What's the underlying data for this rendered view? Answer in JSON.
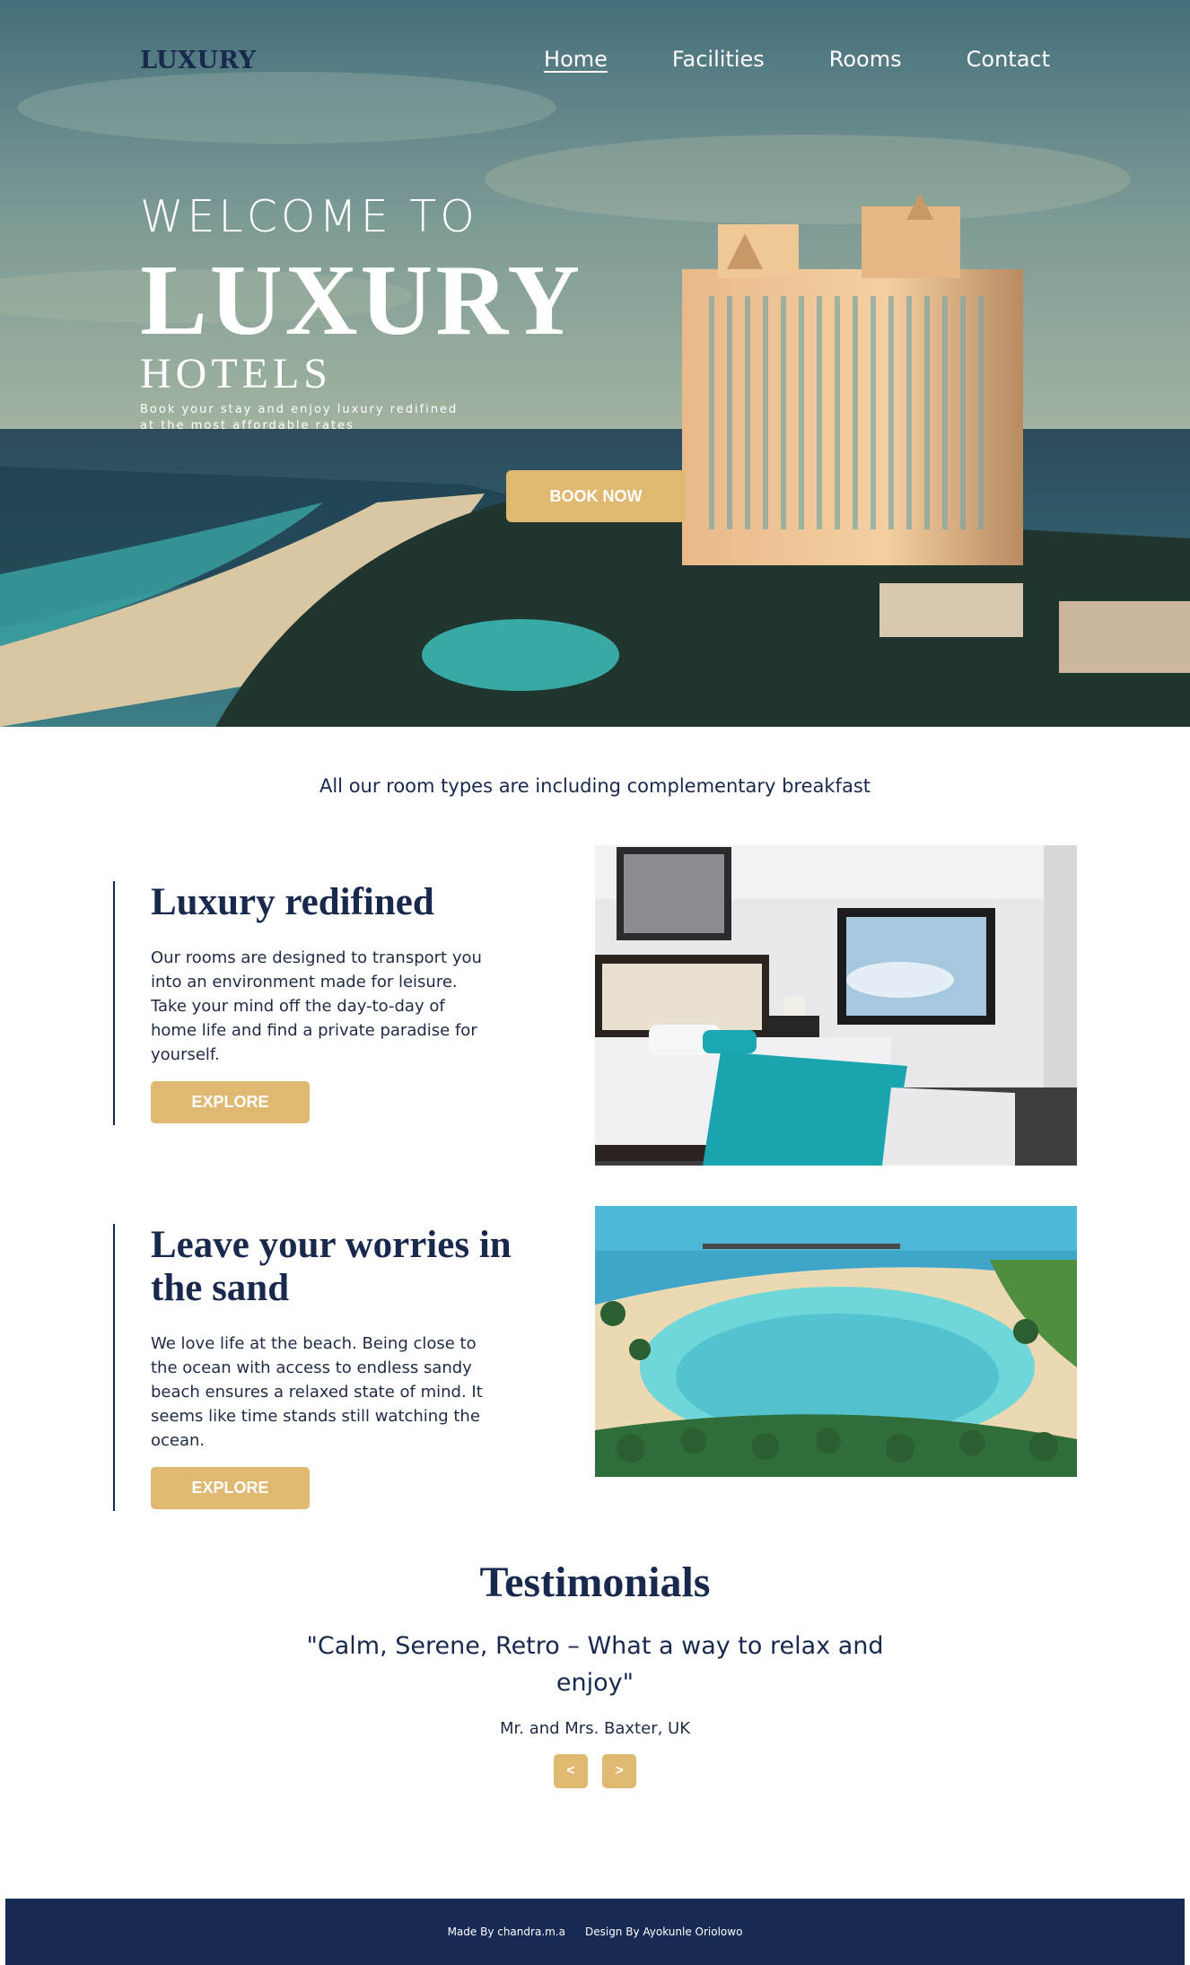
{
  "nav": {
    "logo": "LUXURY",
    "links": [
      "Home",
      "Facilities",
      "Rooms",
      "Contact"
    ]
  },
  "hero": {
    "welcome": "WELCOME TO",
    "title": "LUXURY",
    "subtitle": "HOTELS",
    "tagline": "Book your stay and enjoy luxury redifined at the most affordable rates",
    "cta": "BOOK NOW"
  },
  "breakfast_note": "All our room types are including complementary breakfast",
  "features": [
    {
      "title": "Luxury redifined",
      "body": "Our rooms are designed to transport you into an environment made for leisure. Take your mind off the day-to-day of home life and find a private paradise for yourself.",
      "button": "EXPLORE"
    },
    {
      "title": "Leave your worries in the sand",
      "body": "We love life at the beach. Being close to the ocean with access to endless sandy beach ensures a relaxed state of mind. It seems like time stands still watching the ocean.",
      "button": "EXPLORE"
    }
  ],
  "testimonials": {
    "title": "Testimonials",
    "quote": "\"Calm, Serene, Retro – What a way to relax and enjoy\"",
    "author": "Mr. and Mrs. Baxter, UK",
    "prev": "<",
    "next": ">"
  },
  "footer": {
    "made_by": "Made By chandra.m.a",
    "design_by": "Design By Ayokunle Oriolowo"
  },
  "colors": {
    "navy": "#18294d",
    "gold": "#dfb872",
    "footer": "#162a53"
  }
}
